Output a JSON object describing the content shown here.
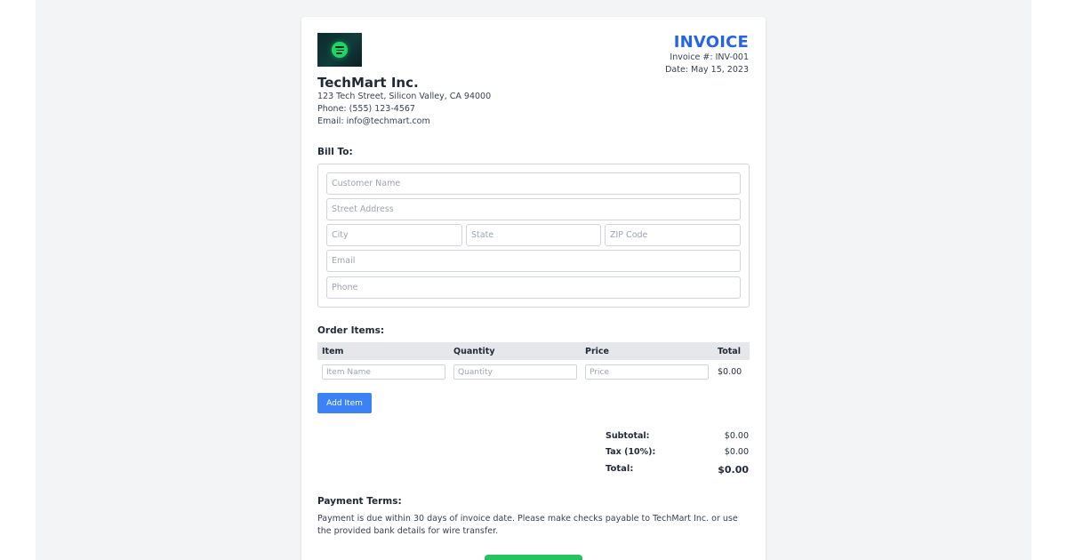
{
  "company": {
    "name": "TechMart Inc.",
    "address": "123 Tech Street, Silicon Valley, CA 94000",
    "phone": "Phone: (555) 123-4567",
    "email": "Email: info@techmart.com"
  },
  "invoice": {
    "title": "INVOICE",
    "number": "Invoice #: INV-001",
    "date": "Date: May 15, 2023"
  },
  "bill_to": {
    "title": "Bill To:",
    "customer_name": {
      "value": "",
      "placeholder": "Customer Name"
    },
    "street": {
      "value": "",
      "placeholder": "Street Address"
    },
    "city": {
      "value": "",
      "placeholder": "City"
    },
    "state": {
      "value": "",
      "placeholder": "State"
    },
    "zip": {
      "value": "",
      "placeholder": "ZIP Code"
    },
    "email": {
      "value": "",
      "placeholder": "Email"
    },
    "phone": {
      "value": "",
      "placeholder": "Phone"
    }
  },
  "order": {
    "title": "Order Items:",
    "columns": [
      "Item",
      "Quantity",
      "Price",
      "Total"
    ],
    "rows": [
      {
        "item_placeholder": "Item Name",
        "quantity_placeholder": "Quantity",
        "price_placeholder": "Price",
        "total": "$0.00"
      }
    ],
    "add_label": "Add Item"
  },
  "summary": {
    "subtotal_label": "Subtotal:",
    "subtotal": "$0.00",
    "tax_label": "Tax (10%):",
    "tax": "$0.00",
    "total_label": "Total:",
    "total": "$0.00"
  },
  "terms": {
    "title": "Payment Terms:",
    "text": "Payment is due within 30 days of invoice date. Please make checks payable to TechMart Inc. or use the provided bank details for wire transfer."
  },
  "colors": {
    "accent": "#2563eb",
    "add_button": "#3b82f6",
    "submit_button": "#22c55e",
    "logo_mark": "#1ed760"
  },
  "icons": {
    "logo": "music-streaming-logo"
  }
}
